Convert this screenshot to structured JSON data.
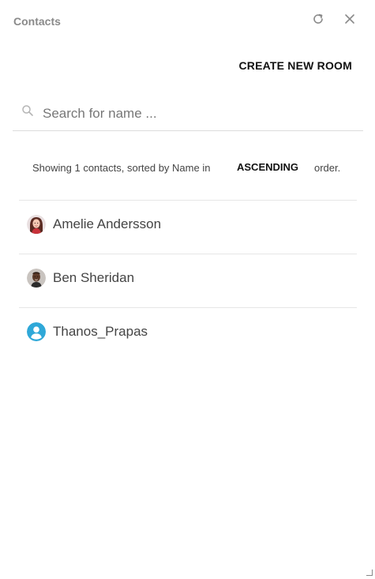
{
  "header": {
    "title": "Contacts",
    "refresh_icon": "refresh-icon",
    "close_icon": "close-icon"
  },
  "actions": {
    "create_room_label": "CREATE NEW ROOM"
  },
  "search": {
    "placeholder": "Search for name ...",
    "value": "",
    "icon": "search-icon"
  },
  "summary": {
    "text": "Showing 1 contacts, sorted by Name in",
    "order": "ASCENDING",
    "tail": "order."
  },
  "contacts": [
    {
      "name": "Amelie Andersson",
      "avatar": "photo-woman"
    },
    {
      "name": "Ben Sheridan",
      "avatar": "photo-man"
    },
    {
      "name": "Thanos_Prapas",
      "avatar": "default-user-icon"
    }
  ],
  "colors": {
    "title": "#8a8a8a",
    "divider": "#e6e6e6",
    "default_avatar": "#2fa8d8"
  }
}
